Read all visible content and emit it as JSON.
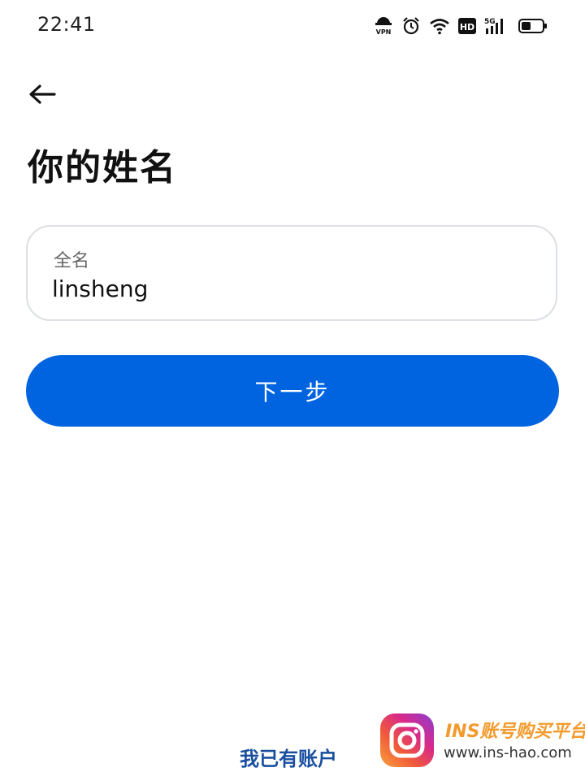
{
  "status_bar": {
    "time": "22:41",
    "icons": [
      "vpn-icon",
      "alarm-icon",
      "wifi-icon",
      "hd-icon",
      "signal-5g-icon",
      "battery-icon"
    ]
  },
  "header": {
    "back_icon": "arrow-left-icon",
    "title": "你的姓名"
  },
  "form": {
    "full_name": {
      "label": "全名",
      "value": "linsheng"
    },
    "next_label": "下一步"
  },
  "footer": {
    "login_link": "我已有账户"
  },
  "watermark": {
    "title": "INS账号购买平台",
    "url": "www.ins-hao.com"
  },
  "colors": {
    "primary": "#0064e0",
    "link": "#1a4fa0",
    "field_border": "#dcdfe3"
  }
}
